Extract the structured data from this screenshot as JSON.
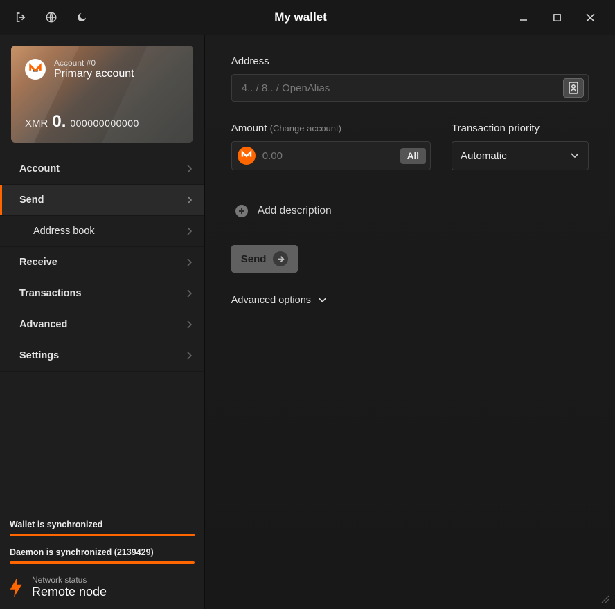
{
  "window": {
    "title": "My wallet"
  },
  "sidebar": {
    "account": {
      "label": "Account #0",
      "name": "Primary account",
      "currency": "XMR",
      "balance_whole": "0.",
      "balance_fraction": "000000000000"
    },
    "nav": {
      "account": "Account",
      "send": "Send",
      "address_book": "Address book",
      "receive": "Receive",
      "transactions": "Transactions",
      "advanced": "Advanced",
      "settings": "Settings"
    },
    "sync": {
      "wallet": "Wallet is synchronized",
      "daemon": "Daemon is synchronized (2139429)"
    },
    "network": {
      "label": "Network status",
      "value": "Remote node"
    }
  },
  "main": {
    "address_label": "Address",
    "address_placeholder": "4.. / 8.. / OpenAlias",
    "amount_label": "Amount",
    "change_account": "(Change account)",
    "amount_placeholder": "0.00",
    "all_button": "All",
    "priority_label": "Transaction priority",
    "priority_value": "Automatic",
    "add_description": "Add description",
    "send_button": "Send",
    "advanced_options": "Advanced options"
  }
}
